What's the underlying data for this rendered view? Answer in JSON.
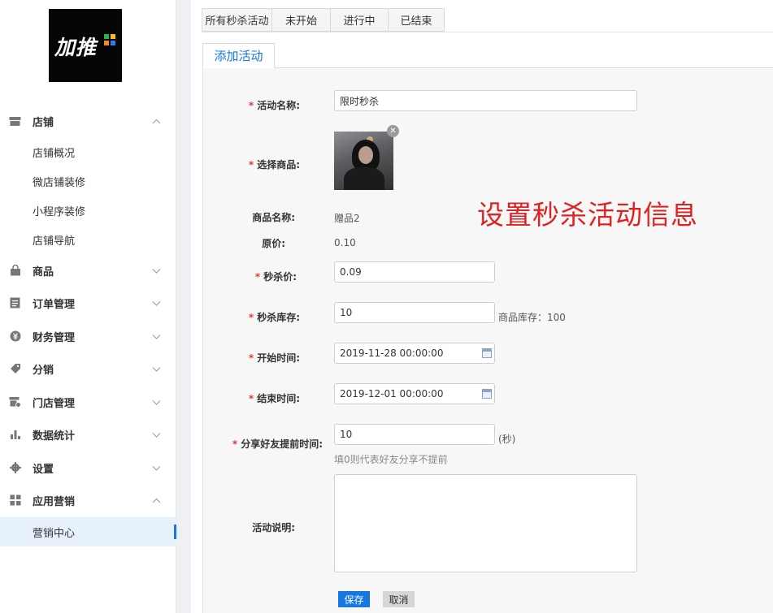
{
  "logo": {
    "text": "加推"
  },
  "sidebar": {
    "groups": [
      {
        "label": "店铺",
        "icon": "store-icon",
        "chevron": "up"
      },
      {
        "label": "商品",
        "icon": "bag-icon",
        "chevron": "down"
      },
      {
        "label": "订单管理",
        "icon": "order-icon",
        "chevron": "down"
      },
      {
        "label": "财务管理",
        "icon": "finance-icon",
        "chevron": "down"
      },
      {
        "label": "分销",
        "icon": "tag-icon",
        "chevron": "down"
      },
      {
        "label": "门店管理",
        "icon": "shop-settings-icon",
        "chevron": "down"
      },
      {
        "label": "数据统计",
        "icon": "bar-chart-icon",
        "chevron": "down"
      },
      {
        "label": "设置",
        "icon": "gear-icon",
        "chevron": "down"
      },
      {
        "label": "应用营销",
        "icon": "apps-icon",
        "chevron": "up"
      }
    ],
    "store_sub": [
      "店铺概况",
      "微店铺装修",
      "小程序装修",
      "店铺导航"
    ],
    "marketing_sub": [
      "营销中心"
    ]
  },
  "tabs": [
    "所有秒杀活动",
    "未开始",
    "进行中",
    "已结束"
  ],
  "subtab": "添加活动",
  "form": {
    "name_label": "活动名称:",
    "name_value": "限时秒杀",
    "product_label": "选择商品:",
    "product_name_label": "商品名称:",
    "product_name_value": "赠品2",
    "original_price_label": "原价:",
    "original_price_value": "0.10",
    "seckill_price_label": "秒杀价:",
    "seckill_price_value": "0.09",
    "stock_label": "秒杀库存:",
    "stock_value": "10",
    "stock_hint": "商品库存：100",
    "start_label": "开始时间:",
    "start_value": "2019-11-28 00:00:00",
    "end_label": "结束时间:",
    "end_value": "2019-12-01 00:00:00",
    "share_label": "分享好友提前时间:",
    "share_value": "10",
    "share_unit": "(秒)",
    "share_hint": "填0则代表好友分享不提前",
    "desc_label": "活动说明:",
    "required_mark": "*",
    "save": "保存",
    "cancel": "取消"
  },
  "annotation": "设置秒杀活动信息",
  "colors": {
    "accent": "#1677e0",
    "required": "#e4393c",
    "annotation": "#e02121"
  }
}
